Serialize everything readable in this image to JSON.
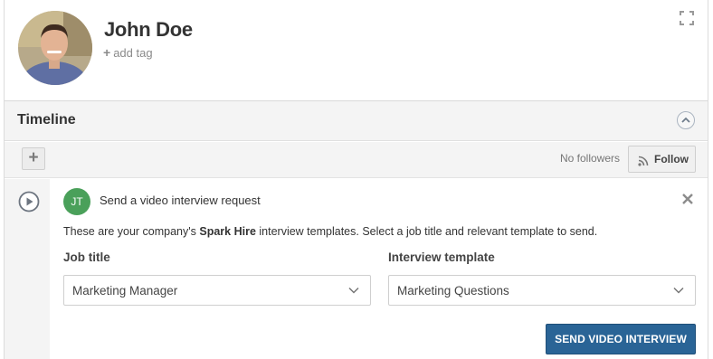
{
  "profile": {
    "name": "John Doe",
    "add_tag": "add tag"
  },
  "timeline": {
    "title": "Timeline",
    "followers_text": "No followers",
    "follow_label": "Follow",
    "add_symbol": "+"
  },
  "activity": {
    "initials": "JT",
    "initials_color": "#4aa05a",
    "title": "Send a video interview request",
    "description_pre": "These are your company's ",
    "description_brand": "Spark Hire",
    "description_post": " interview templates. Select a job title and relevant template to send.",
    "job_title_label": "Job title",
    "job_title_value": "Marketing Manager",
    "template_label": "Interview template",
    "template_value": "Marketing Questions",
    "send_label": "SEND VIDEO INTERVIEW",
    "send_color": "#2a6496"
  },
  "icons": {
    "expand": "expand-icon",
    "collapse": "chevron-up-icon",
    "rss": "rss-icon",
    "play": "play-circle-icon",
    "close": "close-icon",
    "chevron": "chevron-down-icon"
  }
}
